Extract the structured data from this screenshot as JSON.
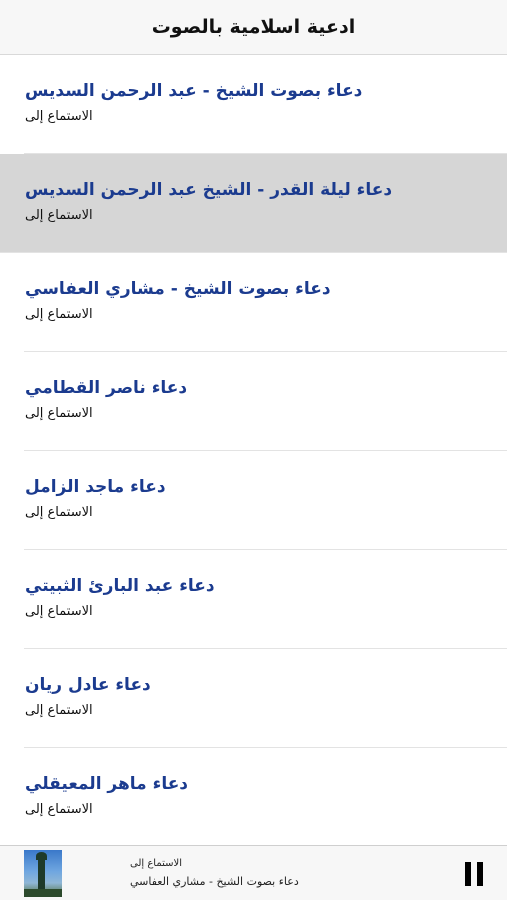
{
  "header": {
    "title": "ادعية اسلامية بالصوت"
  },
  "list": {
    "items": [
      {
        "title": "دعاء بصوت الشيخ - عبد الرحمن السديس",
        "subtitle": "الاستماع إلى",
        "selected": false
      },
      {
        "title": "دعاء ليلة القدر - الشيخ عبد الرحمن السديس",
        "subtitle": "الاستماع إلى",
        "selected": true
      },
      {
        "title": "دعاء بصوت الشيخ - مشاري العفاسي",
        "subtitle": "الاستماع إلى",
        "selected": false
      },
      {
        "title": "دعاء ناصر القطامي",
        "subtitle": "الاستماع إلى",
        "selected": false
      },
      {
        "title": "دعاء ماجد الزامل",
        "subtitle": "الاستماع إلى",
        "selected": false
      },
      {
        "title": "دعاء عبد البارئ الثبيتي",
        "subtitle": "الاستماع إلى",
        "selected": false
      },
      {
        "title": "دعاء عادل ريان",
        "subtitle": "الاستماع إلى",
        "selected": false
      },
      {
        "title": "دعاء ماهر المعيقلي",
        "subtitle": "الاستماع إلى",
        "selected": false
      }
    ]
  },
  "player": {
    "subtitle": "الاستماع إلى",
    "title": "دعاء بصوت الشيخ - مشاري العفاسي",
    "thumbnail_icon": "mosque-minaret-icon",
    "control_icon": "pause-icon"
  },
  "colors": {
    "title_text": "#1b3b8f",
    "selected_row": "#d6d6d6",
    "bar_background": "#f7f7f7"
  }
}
